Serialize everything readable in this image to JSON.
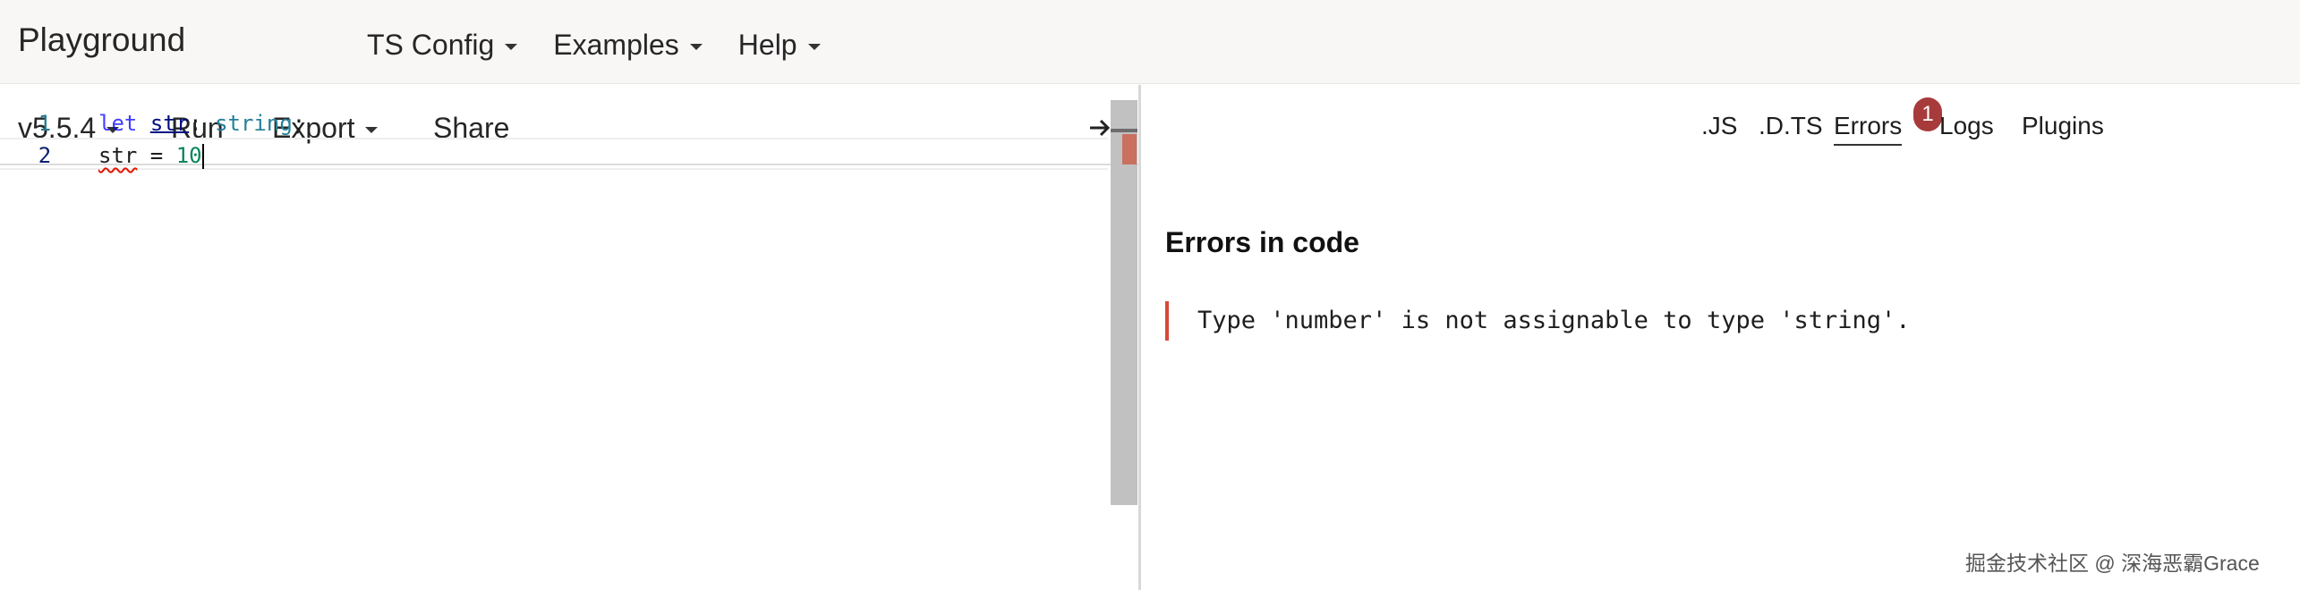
{
  "app": {
    "title": "Playground"
  },
  "top_nav": {
    "items": [
      {
        "label": "TS Config"
      },
      {
        "label": "Examples"
      },
      {
        "label": "Help"
      }
    ]
  },
  "editor_toolbar": {
    "version_label": "v5.5.4",
    "run_label": "Run",
    "export_label": "Export",
    "share_label": "Share",
    "collapse_icon": "collapse-right-arrow-icon"
  },
  "editor": {
    "lines": [
      {
        "number": "1",
        "tokens": {
          "kw": "let",
          "sp1": " ",
          "ident": "str",
          "colon": ": ",
          "type": "string",
          "semi": ";"
        }
      },
      {
        "number": "2",
        "tokens": {
          "err_ident": "str",
          "op": " = ",
          "num": "10"
        }
      }
    ]
  },
  "output_tabs": {
    "js": ".JS",
    "dts": ".D.TS",
    "errors": "Errors",
    "errors_badge": "1",
    "logs": "Logs",
    "plugins": "Plugins"
  },
  "errors_panel": {
    "heading": "Errors in code",
    "errors": [
      {
        "message": "Type 'number' is not assignable to type 'string'."
      }
    ]
  },
  "watermark": {
    "text": "掘金技术社区 @ 深海恶霸Grace"
  },
  "colors": {
    "topbar_bg": "#f8f7f6",
    "error_accent": "#d9473a",
    "badge_bg": "#a73b3b",
    "scrollbar": "#c1c1c1"
  }
}
